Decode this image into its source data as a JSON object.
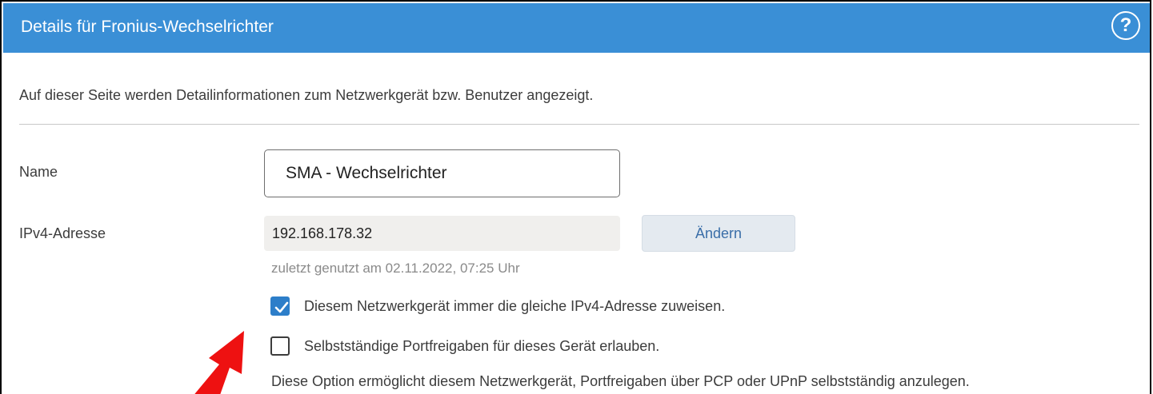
{
  "header": {
    "title": "Details für Fronius-Wechselrichter",
    "help_icon": "help-circle-icon"
  },
  "intro_text": "Auf dieser Seite werden Detailinformationen zum Netzwerkgerät bzw. Benutzer angezeigt.",
  "form": {
    "name_label": "Name",
    "name_value": "SMA - Wechselrichter",
    "ipv4_label": "IPv4-Adresse",
    "ipv4_value": "192.168.178.32",
    "change_button_label": "Ändern",
    "last_used": "zuletzt genutzt am 02.11.2022, 07:25 Uhr"
  },
  "options": [
    {
      "label": "Diesem Netzwerkgerät immer die gleiche IPv4-Adresse zuweisen.",
      "checked": true
    },
    {
      "label": "Selbstständige Portfreigaben für dieses Gerät erlauben.",
      "checked": false
    }
  ],
  "option_note": "Diese Option ermöglicht diesem Netzwerkgerät, Portfreigaben über PCP oder UPnP selbstständig anzulegen.",
  "colors": {
    "header_bg": "#3a8fd6",
    "checkbox_checked": "#2d7ec9",
    "annotation_arrow": "#ee1111"
  }
}
